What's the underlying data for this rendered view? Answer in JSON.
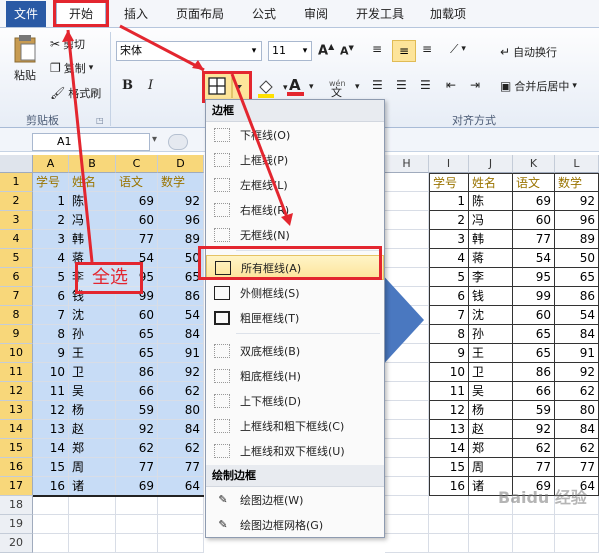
{
  "menu": {
    "file": "文件",
    "home": "开始",
    "insert": "插入",
    "page_layout": "页面布局",
    "formulas": "公式",
    "review": "审阅",
    "developer": "开发工具",
    "addins": "加载项"
  },
  "ribbon": {
    "paste": "粘贴",
    "cut": "剪切",
    "copy": "复制",
    "format_painter": "格式刷",
    "clipboard_group": "剪贴板",
    "font_name": "宋体",
    "font_size": "11",
    "bold": "B",
    "italic": "I",
    "wrap_text": "自动换行",
    "merge_center": "合并后居中",
    "alignment_group": "对齐方式"
  },
  "formula": {
    "name_box": "A1"
  },
  "columns_left": [
    "A",
    "B",
    "C",
    "D"
  ],
  "columns_mid": [
    "H"
  ],
  "columns_right": [
    "I",
    "J",
    "K",
    "L"
  ],
  "rows": [
    "1",
    "2",
    "3",
    "4",
    "5",
    "6",
    "7",
    "8",
    "9",
    "10",
    "11",
    "12",
    "13",
    "14",
    "15",
    "16",
    "17",
    "18",
    "19",
    "20"
  ],
  "headers": [
    "学号",
    "姓名",
    "语文",
    "数学"
  ],
  "students": [
    {
      "id": "1",
      "name": "陈",
      "chinese": "69",
      "math": "92"
    },
    {
      "id": "2",
      "name": "冯",
      "chinese": "60",
      "math": "96"
    },
    {
      "id": "3",
      "name": "韩",
      "chinese": "77",
      "math": "89"
    },
    {
      "id": "4",
      "name": "蒋",
      "chinese": "54",
      "math": "50"
    },
    {
      "id": "5",
      "name": "李",
      "chinese": "95",
      "math": "65"
    },
    {
      "id": "6",
      "name": "钱",
      "chinese": "99",
      "math": "86"
    },
    {
      "id": "7",
      "name": "沈",
      "chinese": "60",
      "math": "54"
    },
    {
      "id": "8",
      "name": "孙",
      "chinese": "65",
      "math": "84"
    },
    {
      "id": "9",
      "name": "王",
      "chinese": "65",
      "math": "91"
    },
    {
      "id": "10",
      "name": "卫",
      "chinese": "86",
      "math": "92"
    },
    {
      "id": "11",
      "name": "吴",
      "chinese": "66",
      "math": "62"
    },
    {
      "id": "12",
      "name": "杨",
      "chinese": "59",
      "math": "80"
    },
    {
      "id": "13",
      "name": "赵",
      "chinese": "92",
      "math": "84"
    },
    {
      "id": "14",
      "name": "郑",
      "chinese": "62",
      "math": "62"
    },
    {
      "id": "15",
      "name": "周",
      "chinese": "77",
      "math": "77"
    },
    {
      "id": "16",
      "name": "诸",
      "chinese": "69",
      "math": "64"
    }
  ],
  "annotation": {
    "select_all": "全选"
  },
  "dropdown": {
    "section_borders": "边框",
    "items": [
      "下框线(O)",
      "上框线(P)",
      "左框线(L)",
      "右框线(R)",
      "无框线(N)",
      "所有框线(A)",
      "外侧框线(S)",
      "粗匣框线(T)",
      "双底框线(B)",
      "粗底框线(H)",
      "上下框线(D)",
      "上框线和粗下框线(C)",
      "上框线和双下框线(U)"
    ],
    "section_draw": "绘制边框",
    "draw_items": [
      "绘图边框(W)",
      "绘图边框网格(G)"
    ]
  },
  "colors": {
    "accent_red": "#e3262f",
    "selection": "#c7dcf6",
    "header_gold": "#f8d77a",
    "arrow_blue": "#4a78c0"
  },
  "watermark": "Baidu 经验"
}
